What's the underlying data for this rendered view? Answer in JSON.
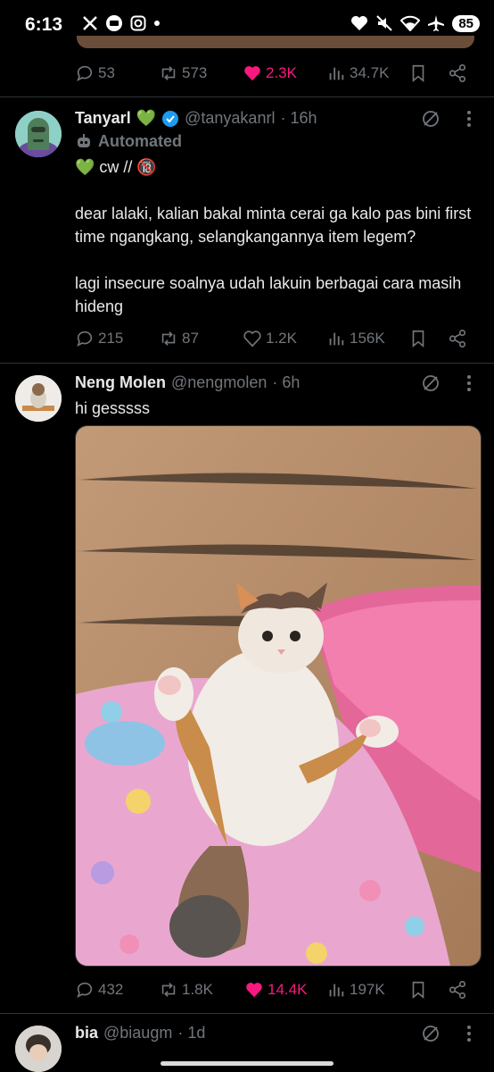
{
  "status_bar": {
    "time": "6:13",
    "left_icons": [
      "x-icon",
      "mail-icon",
      "instagram-icon",
      "dot-icon"
    ],
    "right_icons": [
      "heart-icon",
      "mute-icon",
      "wifi-icon",
      "airplane-icon"
    ],
    "battery": "85"
  },
  "prev_tweet": {
    "actions": {
      "replies": "53",
      "reposts": "573",
      "likes": "2.3K",
      "views": "34.7K"
    }
  },
  "tweets": [
    {
      "name": "Tanyarl",
      "name_emoji": "💚",
      "verified": true,
      "handle": "@tanyakanrl",
      "time": "· 16h",
      "automated_label": "Automated",
      "cw_line": "💚 cw // 🔞",
      "text": "dear lalaki, kalian bakal minta cerai ga kalo pas bini first time ngangkang, selangkangannya item legem?\n\nlagi insecure soalnya udah lakuin berbagai cara masih hideng",
      "actions": {
        "replies": "215",
        "reposts": "87",
        "likes": "1.2K",
        "views": "156K"
      }
    },
    {
      "name": "Neng Molen",
      "handle": "@nengmolen",
      "time": "· 6h",
      "text": "hi gesssss",
      "media_alt": "cat photo",
      "actions": {
        "replies": "432",
        "reposts": "1.8K",
        "likes": "14.4K",
        "views": "197K"
      }
    },
    {
      "name": "bia",
      "handle": "@biaugm",
      "time": "· 1d"
    }
  ],
  "colors": {
    "bg": "#000000",
    "text": "#e7e9ea",
    "muted": "#71767b",
    "like": "#f91880",
    "verified": "#1d9bf0"
  }
}
